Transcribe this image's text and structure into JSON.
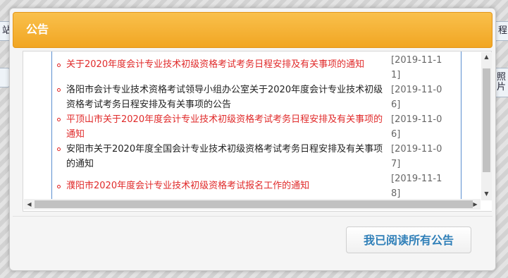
{
  "background": {
    "left_chips": [
      "站",
      ""
    ],
    "right_chips": [
      "程",
      "照片"
    ]
  },
  "dialog": {
    "title": "公告",
    "items": [
      {
        "title": "关于2020年度会计专业技术初级资格考试考务日程安排及有关事项的通知",
        "date": "[2019-11-11]",
        "color": "red"
      },
      {
        "title": "洛阳市会计专业技术资格考试领导小组办公室关于2020年度会计专业技术初级资格考试考务日程安排及有关事项的公告",
        "date": "[2019-11-06]",
        "color": "black"
      },
      {
        "title": "平顶山市关于2020年度会计专业技术初级资格考试考务日程安排及有关事项的通知",
        "date": "[2019-11-06]",
        "color": "red"
      },
      {
        "title": "安阳市关于2020年度全国会计专业技术初级资格考试考务日程安排及有关事项的通知",
        "date": "[2019-11-07]",
        "color": "black"
      },
      {
        "title": "濮阳市2020年度会计专业技术初级资格考试报名工作的通知",
        "date": "[2019-11-18]",
        "color": "red"
      }
    ],
    "read_all_button": "我已阅读所有公告",
    "colors": {
      "header": "#f2a930",
      "title_text": "#ffffff",
      "link_red": "#e02a2a",
      "button_text": "#2f7fb8"
    }
  }
}
